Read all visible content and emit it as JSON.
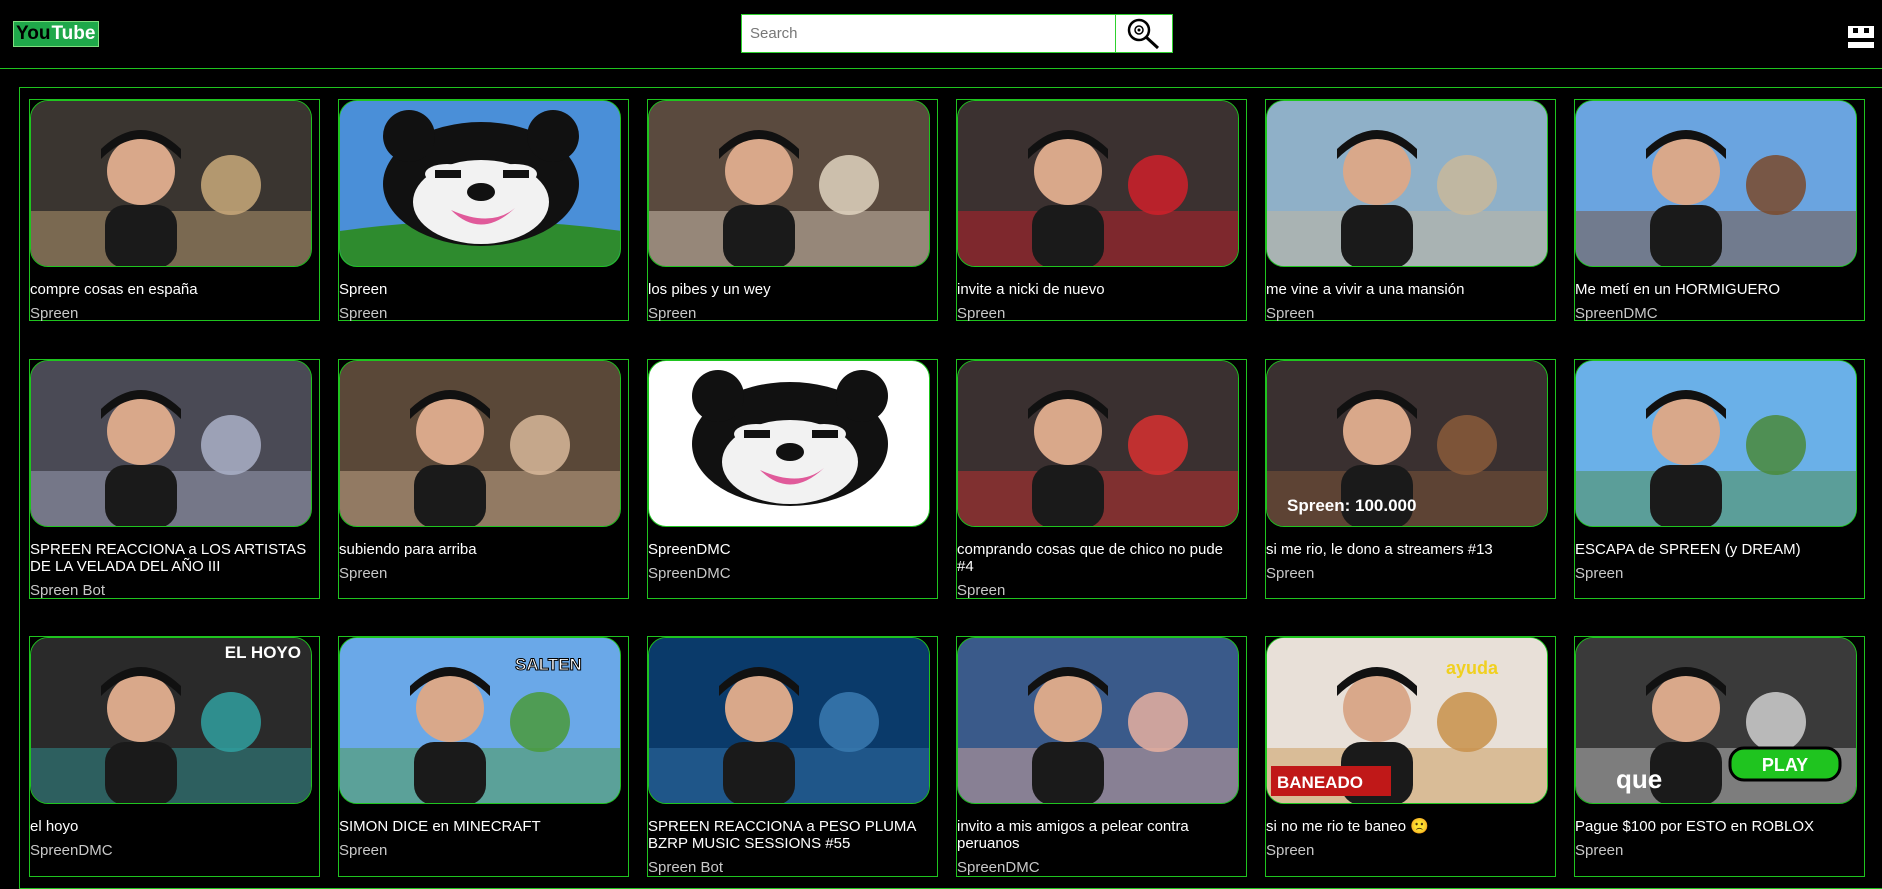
{
  "app": {
    "logo_you": "You",
    "logo_tube": "Tube"
  },
  "search": {
    "placeholder": "Search",
    "value": ""
  },
  "icons": {
    "search": "magnifier-icon",
    "account": "account-icon"
  },
  "colors": {
    "accent": "#1fc41f",
    "background": "#000000"
  },
  "videos": [
    {
      "title": "compre cosas en españa",
      "channel": "Spreen",
      "bg": "#3a3530",
      "fg": "#c9a97a"
    },
    {
      "title": "Spreen",
      "channel": "Spreen",
      "bg": "#4a8fd8",
      "fg": "#2e8b2e",
      "logo": true
    },
    {
      "title": "los pibes y un wey",
      "channel": "Spreen",
      "bg": "#5a4a3e",
      "fg": "#e0d3c0"
    },
    {
      "title": "invite a nicki de nuevo",
      "channel": "Spreen",
      "bg": "#3b3130",
      "fg": "#d0202a"
    },
    {
      "title": "me vine a vivir a una mansión",
      "channel": "Spreen",
      "bg": "#8fb0c8",
      "fg": "#c9b89a"
    },
    {
      "title": "Me metí en un HORMIGUERO",
      "channel": "SpreenDMC",
      "bg": "#6aa4e0",
      "fg": "#7a4a2a"
    },
    {
      "title": "SPREEN REACCIONA a LOS ARTISTAS DE LA VELADA DEL AÑO III",
      "channel": "Spreen Bot",
      "bg": "#4a4a55",
      "fg": "#aab0c8"
    },
    {
      "title": "subiendo para arriba",
      "channel": "Spreen",
      "bg": "#5a4838",
      "fg": "#d8b89a"
    },
    {
      "title": "SpreenDMC",
      "channel": "SpreenDMC",
      "bg": "#ffffff",
      "fg": "#ffffff",
      "logo": true
    },
    {
      "title": "comprando cosas que de chico no pude #4",
      "channel": "Spreen",
      "bg": "#3a3030",
      "fg": "#d83030"
    },
    {
      "title": "si me rio, le dono a streamers #13",
      "channel": "Spreen",
      "bg": "#3a3030",
      "fg": "#8a5a3a",
      "caption": "Spreen: 100.000"
    },
    {
      "title": "ESCAPA de SPREEN (y DREAM)",
      "channel": "Spreen",
      "bg": "#6ab0e8",
      "fg": "#4a8a3a"
    },
    {
      "title": "el hoyo",
      "channel": "SpreenDMC",
      "bg": "#2a2a2a",
      "fg": "#30a0a0",
      "caption": "EL HOYO"
    },
    {
      "title": "SIMON DICE en MINECRAFT",
      "channel": "Spreen",
      "bg": "#6aa8e8",
      "fg": "#4a9a3a",
      "caption": "SALTEN"
    },
    {
      "title": "SPREEN REACCIONA a PESO PLUMA BZRP MUSIC SESSIONS #55",
      "channel": "Spreen Bot",
      "bg": "#0a3a6a",
      "fg": "#3a7ab0"
    },
    {
      "title": "invito a mis amigos a pelear contra peruanos",
      "channel": "SpreenDMC",
      "bg": "#3a5a8a",
      "fg": "#e8b0a0"
    },
    {
      "title": "si no me rio te baneo 🙁",
      "channel": "Spreen",
      "bg": "#e8e0d8",
      "fg": "#c8904a",
      "caption": "BANEADO",
      "caption2": "ayuda"
    },
    {
      "title": "Pague $100 por ESTO en ROBLOX",
      "channel": "Spreen",
      "bg": "#3a3a3a",
      "fg": "#d0d0d0",
      "caption": "que",
      "caption2": "PLAY"
    }
  ]
}
